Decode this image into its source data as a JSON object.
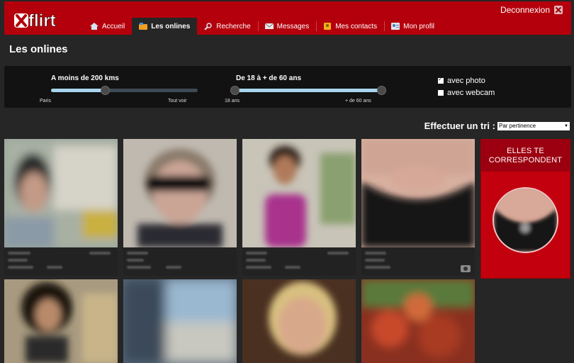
{
  "brand": {
    "logo_text": "flirt"
  },
  "header": {
    "logout_label": "Deconnexion"
  },
  "nav": {
    "items": [
      {
        "label": "Accueil",
        "icon": "home-icon"
      },
      {
        "label": "Les onlines",
        "icon": "users-icon"
      },
      {
        "label": "Recherche",
        "icon": "search-icon"
      },
      {
        "label": "Messages",
        "icon": "mail-icon"
      },
      {
        "label": "Mes contacts",
        "icon": "contacts-icon"
      },
      {
        "label": "Mon profil",
        "icon": "profile-icon"
      }
    ],
    "active": "Les onlines"
  },
  "page": {
    "title": "Les onlines"
  },
  "filters": {
    "distance": {
      "label": "A moins de 200 kms",
      "min_label": "Paris",
      "max_label": "Tout voir",
      "value_fraction": 0.37
    },
    "age": {
      "label": "De 18 à + de 60 ans",
      "min_label": "18 ans",
      "max_label": "+ de 60 ans",
      "low_fraction": 0.0,
      "high_fraction": 1.0
    },
    "photo": {
      "label": "avec photo",
      "checked": true
    },
    "webcam": {
      "label": "avec webcam",
      "checked": false
    }
  },
  "sort": {
    "label": "Effectuer un tri :",
    "selected": "Par pertinence"
  },
  "promo": {
    "title": "ELLES TE CORRESPONDENT"
  },
  "colors": {
    "brand_red": "#b4000c",
    "slider_fill": "#a8d4ee",
    "background": "#262626"
  }
}
